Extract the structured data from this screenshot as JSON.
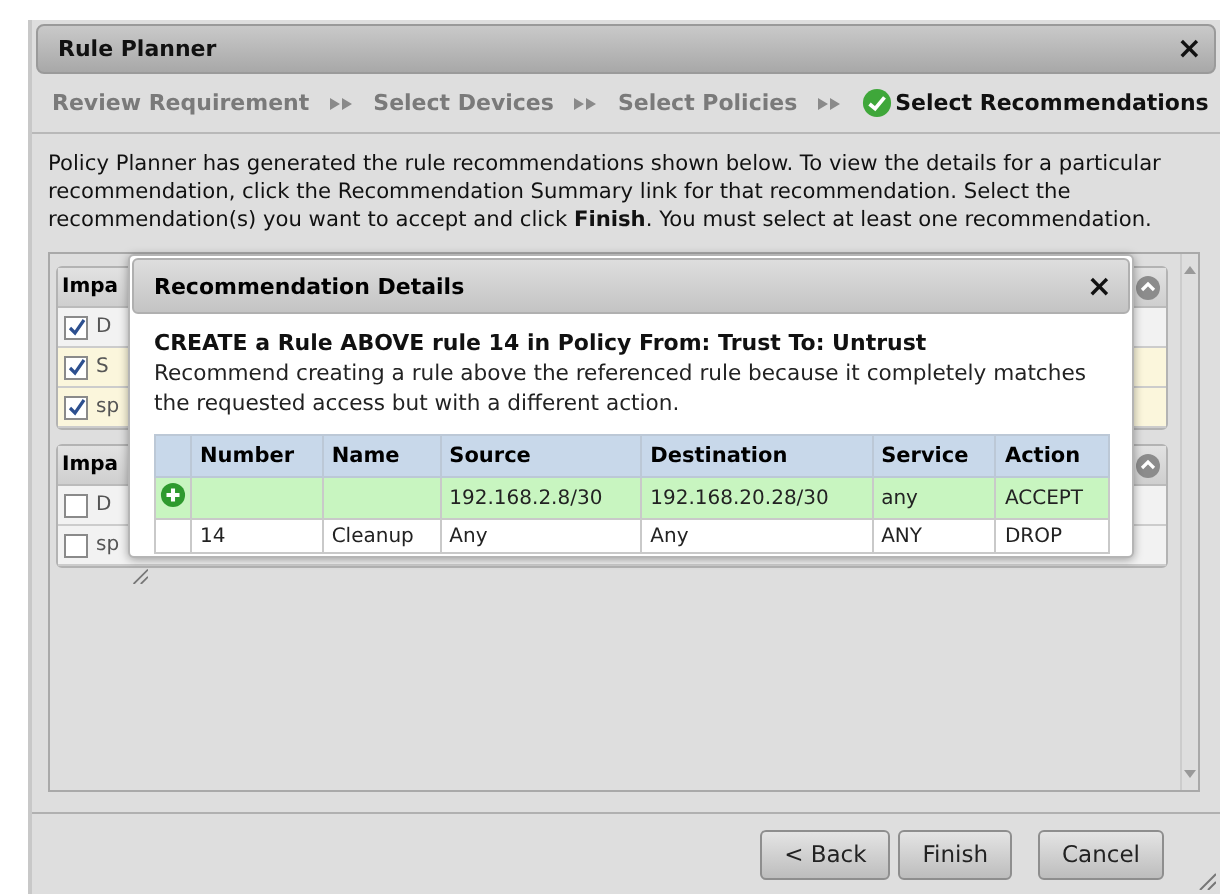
{
  "window": {
    "title": "Rule Planner",
    "close": "×"
  },
  "steps": [
    {
      "label": "Review Requirement",
      "selected": false
    },
    {
      "label": "Select Devices",
      "selected": false
    },
    {
      "label": "Select Policies",
      "selected": false
    },
    {
      "label": "Select Recommendations",
      "selected": true
    }
  ],
  "intro": "Policy Planner has generated the rule recommendations shown below. To view the details for a particular recommendation, click the Recommendation Summary link for that recommendation. Select the recommendation(s) you want to accept and click **Finish**. You must select at least one recommendation.",
  "groups": [
    {
      "header": "Impa",
      "rows": [
        {
          "text": "D",
          "checked": true,
          "highlighted": false
        },
        {
          "text": "S",
          "checked": true,
          "highlighted": true
        },
        {
          "text": "sp",
          "checked": true,
          "highlighted": true
        }
      ]
    },
    {
      "header": "Impa",
      "rows": [
        {
          "text": "D",
          "checked": false,
          "highlighted": false
        },
        {
          "text": "sp",
          "checked": false,
          "highlighted": false
        }
      ]
    }
  ],
  "modal": {
    "title": "Recommendation Details",
    "close": "×",
    "heading": "CREATE a Rule ABOVE rule 14 in Policy From: Trust To: Untrust",
    "description": "Recommend creating a rule above the referenced rule because it completely matches the requested access but with a different action.",
    "columns": [
      "Number",
      "Name",
      "Source",
      "Destination",
      "Service",
      "Action"
    ],
    "rows": [
      {
        "kind": "new",
        "cells": [
          "",
          "",
          "192.168.2.8/30",
          "192.168.20.28/30",
          "any",
          "ACCEPT"
        ]
      },
      {
        "kind": "existing",
        "cells": [
          "14",
          "Cleanup",
          "Any",
          "Any",
          "ANY",
          "DROP"
        ]
      }
    ]
  },
  "buttons": [
    "< Back",
    "Finish",
    "Cancel"
  ]
}
